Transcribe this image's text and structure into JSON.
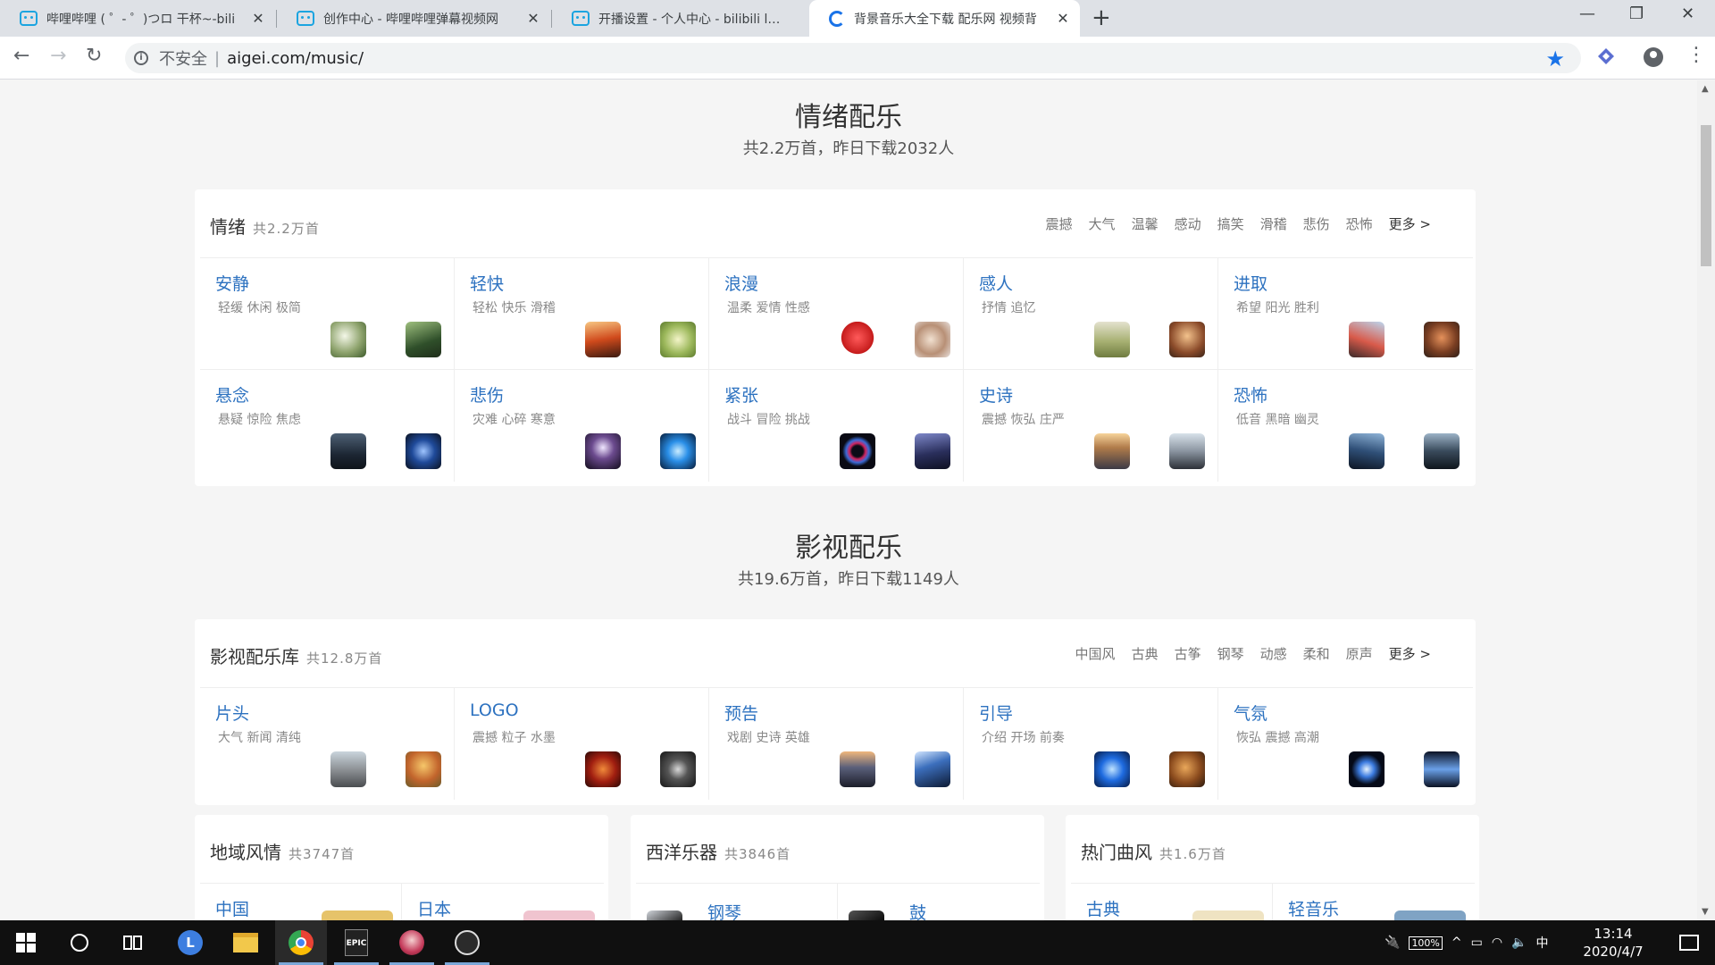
{
  "browser": {
    "tabs": [
      {
        "title": "哔哩哔哩 ( ゜- ゜)つロ 干杯~-bili",
        "icon": "bilibili-icon"
      },
      {
        "title": "创作中心 - 哔哩哔哩弹幕视频网",
        "icon": "bilibili-icon"
      },
      {
        "title": "开播设置 - 个人中心 - bilibili link",
        "icon": "bilibili-icon"
      },
      {
        "title": "背景音乐大全下载 配乐网 视频背",
        "icon": "aigei-icon"
      }
    ],
    "new_tab": "+",
    "controls": {
      "minimize": "—",
      "restore": "❐",
      "close": "✕"
    },
    "security_label": "不安全",
    "url": "aigei.com/music/"
  },
  "sections": [
    {
      "title": "情绪配乐",
      "subtitle": "共2.2万首，昨日下载2032人"
    },
    {
      "title": "影视配乐",
      "subtitle": "共19.6万首，昨日下载1149人"
    }
  ],
  "emotion_panel": {
    "title": "情绪",
    "count": "共2.2万首",
    "tags": [
      "震撼",
      "大气",
      "温馨",
      "感动",
      "搞笑",
      "滑稽",
      "悲伤",
      "恐怖"
    ],
    "more": "更多 >",
    "cells": [
      {
        "title": "安静",
        "sub": "轻缓 休闲 极简"
      },
      {
        "title": "轻快",
        "sub": "轻松 快乐 滑稽"
      },
      {
        "title": "浪漫",
        "sub": "温柔 爱情 性感"
      },
      {
        "title": "感人",
        "sub": "抒情 追忆"
      },
      {
        "title": "进取",
        "sub": "希望 阳光 胜利"
      },
      {
        "title": "悬念",
        "sub": "悬疑 惊险 焦虑"
      },
      {
        "title": "悲伤",
        "sub": "灾难 心碎 寒意"
      },
      {
        "title": "紧张",
        "sub": "战斗 冒险 挑战"
      },
      {
        "title": "史诗",
        "sub": "震撼 恢弘 庄严"
      },
      {
        "title": "恐怖",
        "sub": "低音 黑暗 幽灵"
      }
    ]
  },
  "film_panel": {
    "title": "影视配乐库",
    "count": "共12.8万首",
    "tags": [
      "中国风",
      "古典",
      "古筝",
      "钢琴",
      "动感",
      "柔和",
      "原声"
    ],
    "more": "更多 >",
    "cells": [
      {
        "title": "片头",
        "sub": "大气 新闻 清纯"
      },
      {
        "title": "LOGO",
        "sub": "震撼 粒子 水墨"
      },
      {
        "title": "预告",
        "sub": "戏剧 史诗 英雄"
      },
      {
        "title": "引导",
        "sub": "介绍 开场 前奏"
      },
      {
        "title": "气氛",
        "sub": "恢弘 震撼 高潮"
      }
    ]
  },
  "bottom_panels": [
    {
      "title": "地域风情",
      "count": "共3747首",
      "items": [
        "中国",
        "日本"
      ]
    },
    {
      "title": "西洋乐器",
      "count": "共3846首",
      "items": [
        "钢琴",
        "鼓"
      ]
    },
    {
      "title": "热门曲风",
      "count": "共1.6万首",
      "items": [
        "古典",
        "轻音乐"
      ]
    }
  ],
  "taskbar": {
    "battery": "100%",
    "ime": "中",
    "time": "13:14",
    "date": "2020/4/7"
  }
}
